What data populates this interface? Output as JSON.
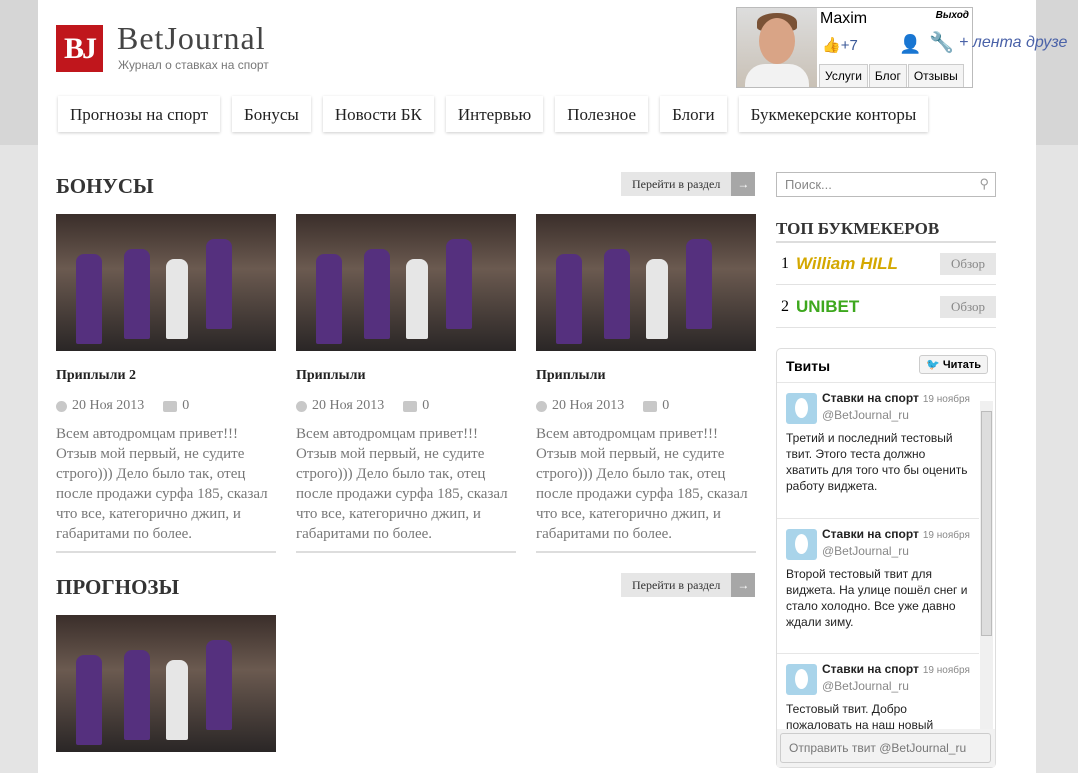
{
  "header": {
    "logo": "BJ",
    "brand": "BetJournal",
    "tagline": "Журнал о ставках на спорт"
  },
  "user": {
    "name": "Maxim",
    "logout": "Выход",
    "likes": "+7",
    "feed": "+ лента друзе",
    "tabs": [
      "Услуги",
      "Блог",
      "Отзывы"
    ]
  },
  "nav": [
    "Прогнозы на спорт",
    "Бонусы",
    "Новости БК",
    "Интервью",
    "Полезное",
    "Блоги",
    "Букмекерские конторы"
  ],
  "sections": [
    {
      "title": "БОНУСЫ",
      "goto": "Перейти в раздел",
      "arrow": "→",
      "cards": [
        {
          "title": "Приплыли 2",
          "date": "20 Ноя 2013",
          "comments": "0",
          "text": "Всем автодромцам привет!!! Отзыв мой первый, не судите строго))) Дело было так, отец после продажи сурфа 185, сказал что все, категорично джип, и габаритами по более."
        },
        {
          "title": "Приплыли",
          "date": "20 Ноя 2013",
          "comments": "0",
          "text": "Всем автодромцам привет!!! Отзыв мой первый, не судите строго))) Дело было так, отец после продажи сурфа 185, сказал что все, категорично джип, и габаритами по более."
        },
        {
          "title": "Приплыли",
          "date": "20 Ноя 2013",
          "comments": "0",
          "text": "Всем автодромцам привет!!! Отзыв мой первый, не судите строго))) Дело было так, отец после продажи сурфа 185, сказал что все, категорично джип, и габаритами по более."
        }
      ]
    },
    {
      "title": "ПРОГНОЗЫ",
      "goto": "Перейти в раздел",
      "arrow": "→"
    }
  ],
  "sidebar": {
    "search_placeholder": "Поиск...",
    "top_title": "ТОП БУКМЕКЕРОВ",
    "bookmakers": [
      {
        "rank": "1",
        "name": "William HILL",
        "review": "Обзор"
      },
      {
        "rank": "2",
        "name": "UNIBET",
        "review": "Обзор"
      }
    ],
    "tweets_title": "Твиты",
    "follow": "Читать",
    "tweets": [
      {
        "author": "Ставки на спорт",
        "date": "19 ноября",
        "handle": "@BetJournal_ru",
        "text": "Третий и последний тестовый твит. Этого теста должно хватить для того что бы оценить работу виджета."
      },
      {
        "author": "Ставки на спорт",
        "date": "19 ноября",
        "handle": "@BetJournal_ru",
        "text": "Второй тестовый твит для виджета. На улице пошёл снег и стало холодно. Все уже давно ждали зиму."
      },
      {
        "author": "Ставки на спорт",
        "date": "19 ноября",
        "handle": "@BetJournal_ru",
        "text": "Тестовый твит. Добро пожаловать на наш новый"
      }
    ],
    "tweet_input": "Отправить твит @BetJournal_ru"
  }
}
